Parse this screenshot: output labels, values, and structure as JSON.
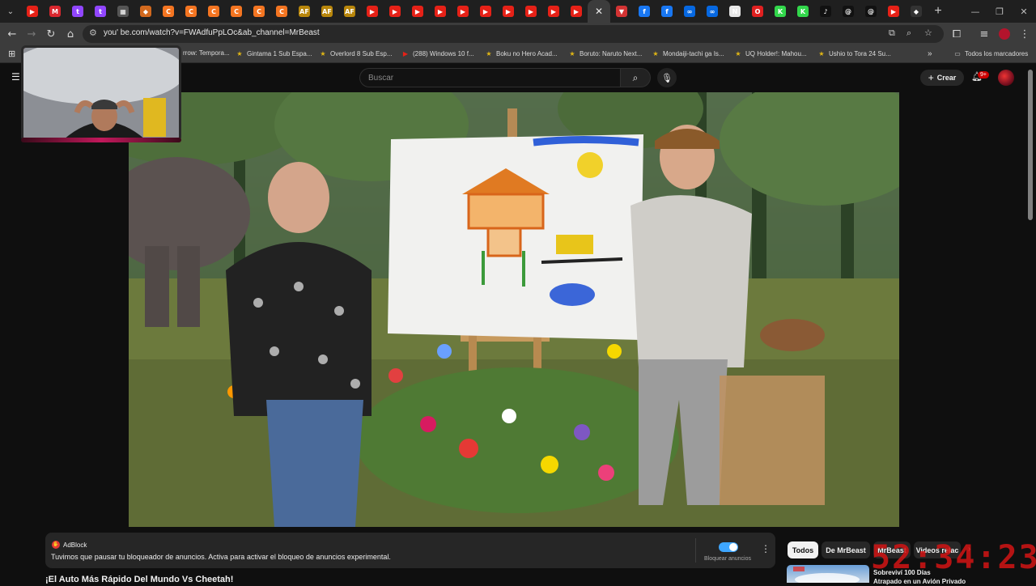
{
  "browser": {
    "tab_favicons": [
      {
        "name": "youtube",
        "color": "#e62117",
        "glyph": "▶"
      },
      {
        "name": "mega",
        "color": "#d9272e",
        "glyph": "M"
      },
      {
        "name": "twitch",
        "color": "#9146ff",
        "glyph": "t"
      },
      {
        "name": "twitch",
        "color": "#9146ff",
        "glyph": "t"
      },
      {
        "name": "grid-site",
        "color": "#555555",
        "glyph": "▦"
      },
      {
        "name": "fox-site",
        "color": "#d2691e",
        "glyph": "◆"
      },
      {
        "name": "crunchyroll",
        "color": "#f47521",
        "glyph": "C"
      },
      {
        "name": "crunchyroll",
        "color": "#f47521",
        "glyph": "C"
      },
      {
        "name": "crunchyroll",
        "color": "#f47521",
        "glyph": "C"
      },
      {
        "name": "crunchyroll",
        "color": "#f47521",
        "glyph": "C"
      },
      {
        "name": "crunchyroll",
        "color": "#f47521",
        "glyph": "C"
      },
      {
        "name": "crunchyroll",
        "color": "#f47521",
        "glyph": "C"
      },
      {
        "name": "animeflv",
        "color": "#b8860b",
        "glyph": "AF"
      },
      {
        "name": "animeflv",
        "color": "#b8860b",
        "glyph": "AF"
      },
      {
        "name": "animeflv",
        "color": "#b8860b",
        "glyph": "AF"
      },
      {
        "name": "youtube",
        "color": "#e62117",
        "glyph": "▶"
      },
      {
        "name": "youtube",
        "color": "#e62117",
        "glyph": "▶"
      },
      {
        "name": "youtube",
        "color": "#e62117",
        "glyph": "▶"
      },
      {
        "name": "youtube",
        "color": "#e62117",
        "glyph": "▶"
      },
      {
        "name": "youtube",
        "color": "#e62117",
        "glyph": "▶"
      },
      {
        "name": "youtube",
        "color": "#e62117",
        "glyph": "▶"
      },
      {
        "name": "youtube",
        "color": "#e62117",
        "glyph": "▶"
      },
      {
        "name": "youtube",
        "color": "#e62117",
        "glyph": "▶"
      },
      {
        "name": "youtube",
        "color": "#e62117",
        "glyph": "▶"
      },
      {
        "name": "youtube",
        "color": "#e62117",
        "glyph": "▶"
      },
      {
        "name": "close",
        "color": "#3c3c3c",
        "glyph": "✕"
      },
      {
        "name": "bookmark-red",
        "color": "#d33333",
        "glyph": "▼"
      },
      {
        "name": "facebook",
        "color": "#1877f2",
        "glyph": "f"
      },
      {
        "name": "facebook",
        "color": "#1877f2",
        "glyph": "f"
      },
      {
        "name": "meta",
        "color": "#0668e1",
        "glyph": "∞"
      },
      {
        "name": "meta",
        "color": "#0668e1",
        "glyph": "∞"
      },
      {
        "name": "notion",
        "color": "#e8e8e8",
        "glyph": "N"
      },
      {
        "name": "opera",
        "color": "#e02020",
        "glyph": "O"
      },
      {
        "name": "kick",
        "color": "#32d74b",
        "glyph": "K"
      },
      {
        "name": "kick",
        "color": "#32d74b",
        "glyph": "K"
      },
      {
        "name": "tiktok",
        "color": "#111111",
        "glyph": "♪"
      },
      {
        "name": "threads",
        "color": "#111111",
        "glyph": "@"
      },
      {
        "name": "threads",
        "color": "#111111",
        "glyph": "@"
      },
      {
        "name": "youtube",
        "color": "#e62117",
        "glyph": "▶"
      },
      {
        "name": "diamond-site",
        "color": "#333333",
        "glyph": "◆"
      }
    ],
    "address": "you' be.com/watch?v=FWAdfuPpLOc&ab_channel=MrBeast",
    "bookmarks": [
      "rrow: Tempora...",
      "Gintama 1 Sub Espa...",
      "Overlord 8 Sub Esp...",
      "(288) Windows 10 f...",
      "Boku no Hero Acad...",
      "Boruto: Naruto Next...",
      "Mondaiji-tachi ga Is...",
      "UQ Holder!: Mahou...",
      "Ushio to Tora 24 Su..."
    ],
    "all_bookmarks": "Todos los marcadores"
  },
  "youtube": {
    "search_placeholder": "Buscar",
    "create_label": "Crear",
    "notif_count": "9+",
    "adblock": {
      "brand": "AdBlock",
      "message": "Tuvimos que pausar tu bloqueador de anuncios. Activa para activar el bloqueo de anuncios experimental.",
      "toggle_label": "Bloquear anuncios"
    },
    "chips": [
      "Todos",
      "De MrBeast",
      "MrBeast",
      "Videos relac"
    ],
    "video_title": "¡El Auto Más Rápido Del Mundo Vs Cheetah!",
    "rec_title_line1": "Sobreviví 100 Días",
    "rec_title_line2": "Atrapado en un Avión Privado"
  },
  "overlay_timer": "52:34:23",
  "colors": {
    "accent": "#3ea6ff",
    "brand_red": "#cc0000",
    "timer": "#d21414"
  }
}
